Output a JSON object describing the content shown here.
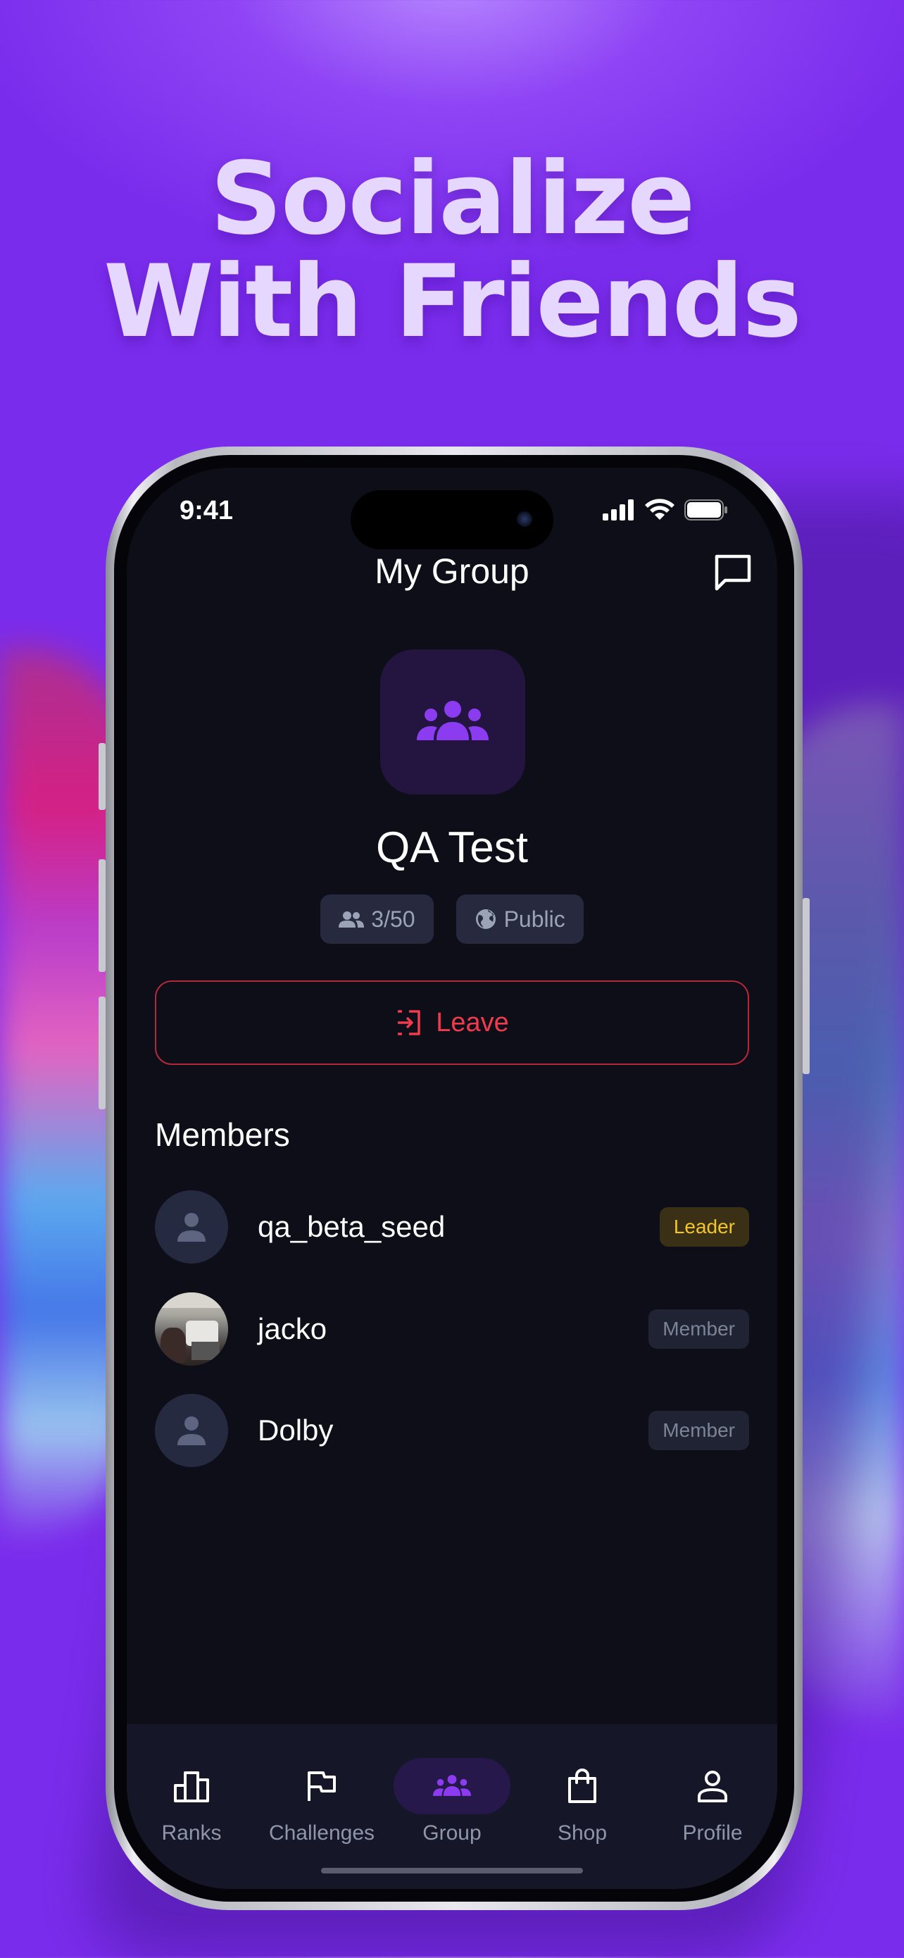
{
  "headline": {
    "line1": "Socialize",
    "line2": "With Friends"
  },
  "status_bar": {
    "time": "9:41"
  },
  "header": {
    "title": "My Group"
  },
  "group": {
    "name": "QA Test",
    "member_count": "3/50",
    "visibility": "Public",
    "leave_label": "Leave"
  },
  "members": {
    "heading": "Members",
    "list": [
      {
        "name": "qa_beta_seed",
        "role": "Leader",
        "avatar": "person-icon"
      },
      {
        "name": "jacko",
        "role": "Member",
        "avatar": "photo"
      },
      {
        "name": "Dolby",
        "role": "Member",
        "avatar": "person-icon"
      }
    ]
  },
  "tabs": [
    {
      "label": "Ranks",
      "icon": "podium-icon"
    },
    {
      "label": "Challenges",
      "icon": "flag-icon"
    },
    {
      "label": "Group",
      "icon": "group-icon",
      "active": true
    },
    {
      "label": "Shop",
      "icon": "shopping-bag-icon"
    },
    {
      "label": "Profile",
      "icon": "person-icon"
    }
  ],
  "colors": {
    "background": "#7a2cec",
    "headline": "#e6d7ff",
    "screen": "#0d0e18",
    "accent": "#8b4cf0",
    "leave": "#ee3b4d",
    "leader_badge": "#f2c52b"
  }
}
